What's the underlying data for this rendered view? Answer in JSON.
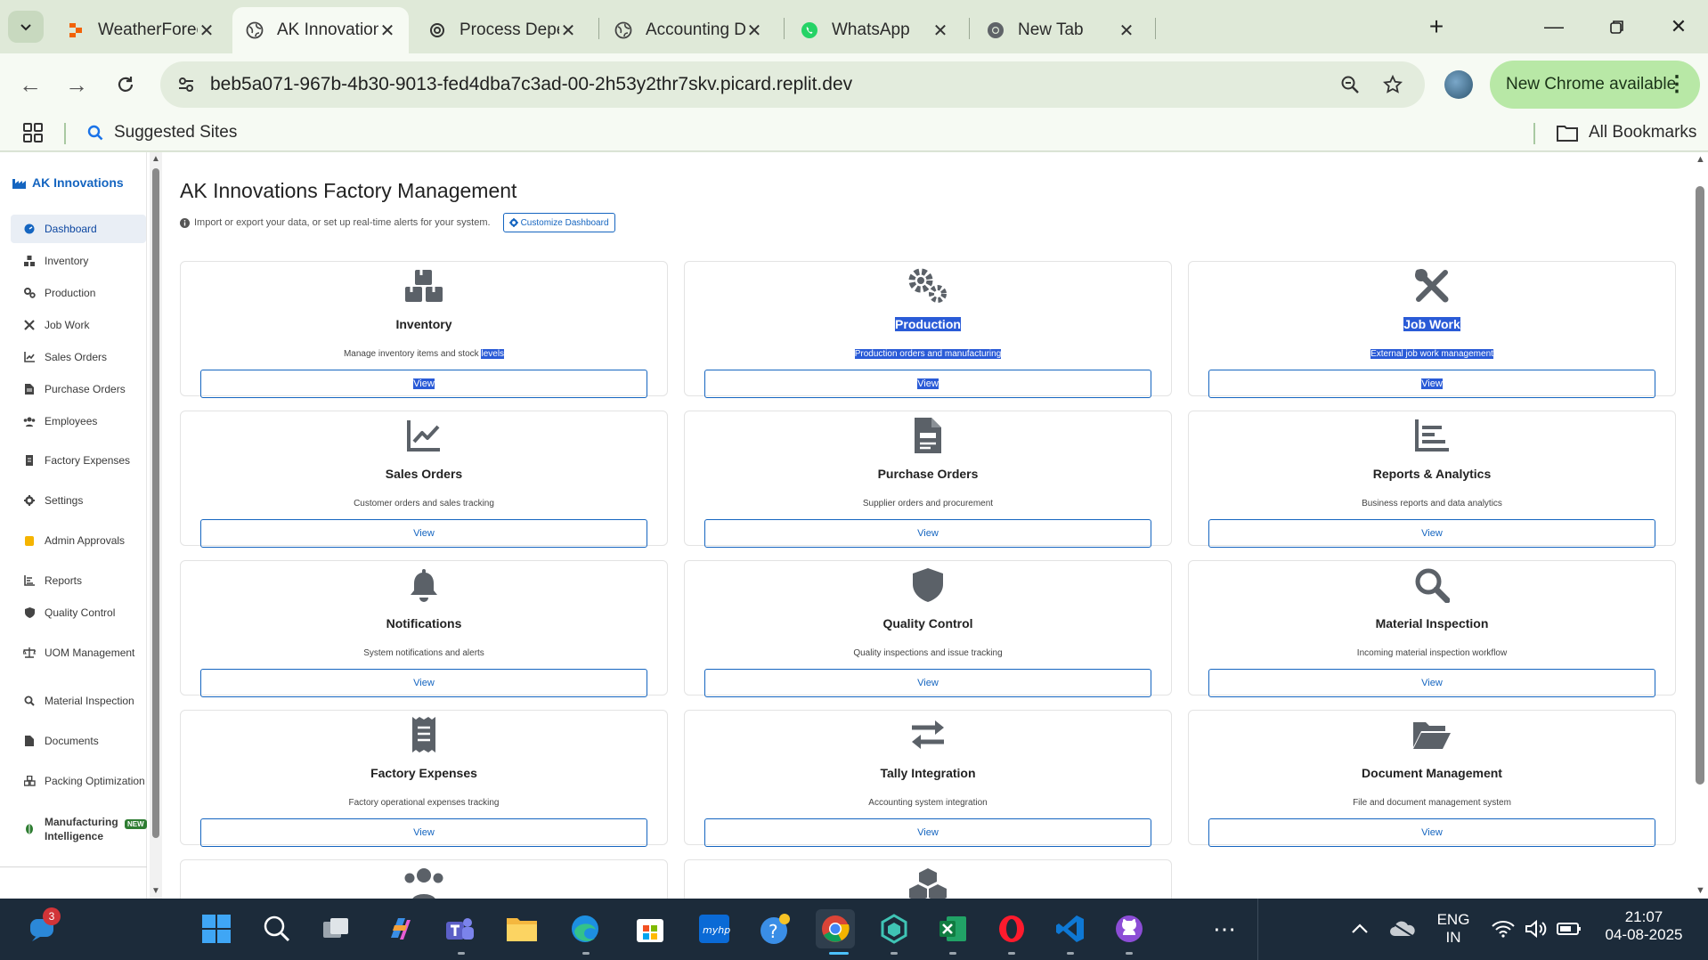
{
  "browser": {
    "tabs": [
      {
        "title": "WeatherForecast -",
        "icon": "replit-icon",
        "active": false
      },
      {
        "title": "AK Innovations Fac",
        "icon": "globe-icon",
        "active": true
      },
      {
        "title": "Process Dependen",
        "icon": "openai-icon",
        "active": false
      },
      {
        "title": "Accounting Dashb",
        "icon": "globe-icon",
        "active": false
      },
      {
        "title": "WhatsApp",
        "icon": "whatsapp-icon",
        "active": false
      },
      {
        "title": "New Tab",
        "icon": "chrome-icon",
        "active": false
      }
    ],
    "url": "beb5a071-967b-4b30-9013-fed4dba7c3ad-00-2h53y2thr7skv.picard.replit.dev",
    "update_label": "New Chrome available",
    "bookmarks": {
      "suggested": "Suggested Sites",
      "all": "All Bookmarks"
    }
  },
  "app": {
    "brand": "AK Innovations",
    "title": "AK Innovations Factory Management",
    "subtitle": "Import or export your data, or set up real-time alerts for your system.",
    "customize_label": "Customize Dashboard",
    "sidebar": [
      {
        "label": "Dashboard",
        "icon": "dashboard-icon",
        "active": true
      },
      {
        "label": "Inventory",
        "icon": "boxes-icon"
      },
      {
        "label": "Production",
        "icon": "gears-icon"
      },
      {
        "label": "Job Work",
        "icon": "tools-icon"
      },
      {
        "label": "Sales Orders",
        "icon": "chart-line-icon"
      },
      {
        "label": "Purchase Orders",
        "icon": "file-icon"
      },
      {
        "label": "Employees",
        "icon": "users-icon"
      },
      {
        "label": "Factory Expenses",
        "icon": "receipt-icon"
      },
      {
        "label": "Settings",
        "icon": "cog-icon"
      },
      {
        "label": "Admin Approvals",
        "icon": "shield-check-icon"
      },
      {
        "label": "Reports",
        "icon": "reports-icon"
      },
      {
        "label": "Quality Control",
        "icon": "shield-icon"
      },
      {
        "label": "UOM Management",
        "icon": "balance-icon"
      },
      {
        "label": "Material Inspection",
        "icon": "search-icon"
      },
      {
        "label": "Documents",
        "icon": "document-icon"
      },
      {
        "label": "Packing Optimization",
        "icon": "cubes-icon"
      },
      {
        "label": "Manufacturing Intelligence",
        "icon": "brain-icon",
        "badge": "NEW"
      }
    ],
    "cards": [
      {
        "title": "Inventory",
        "desc": "Manage inventory items and stock levels",
        "button": "View",
        "icon": "boxes-icon"
      },
      {
        "title": "Production",
        "desc": "Production orders and manufacturing",
        "button": "View",
        "icon": "gears-icon"
      },
      {
        "title": "Job Work",
        "desc": "External job work management",
        "button": "View",
        "icon": "tools-icon"
      },
      {
        "title": "Sales Orders",
        "desc": "Customer orders and sales tracking",
        "button": "View",
        "icon": "chart-line-icon"
      },
      {
        "title": "Purchase Orders",
        "desc": "Supplier orders and procurement",
        "button": "View",
        "icon": "file-icon"
      },
      {
        "title": "Reports & Analytics",
        "desc": "Business reports and data analytics",
        "button": "View",
        "icon": "reports-icon"
      },
      {
        "title": "Notifications",
        "desc": "System notifications and alerts",
        "button": "View",
        "icon": "bell-icon"
      },
      {
        "title": "Quality Control",
        "desc": "Quality inspections and issue tracking",
        "button": "View",
        "icon": "shield-icon"
      },
      {
        "title": "Material Inspection",
        "desc": "Incoming material inspection workflow",
        "button": "View",
        "icon": "search-icon"
      },
      {
        "title": "Factory Expenses",
        "desc": "Factory operational expenses tracking",
        "button": "View",
        "icon": "receipt-icon"
      },
      {
        "title": "Tally Integration",
        "desc": "Accounting system integration",
        "button": "View",
        "icon": "exchange-icon"
      },
      {
        "title": "Document Management",
        "desc": "File and document management system",
        "button": "View",
        "icon": "folder-icon"
      }
    ]
  },
  "taskbar": {
    "notification_count": "3",
    "lang_top": "ENG",
    "lang_bottom": "IN",
    "time": "21:07",
    "date": "04-08-2025"
  }
}
